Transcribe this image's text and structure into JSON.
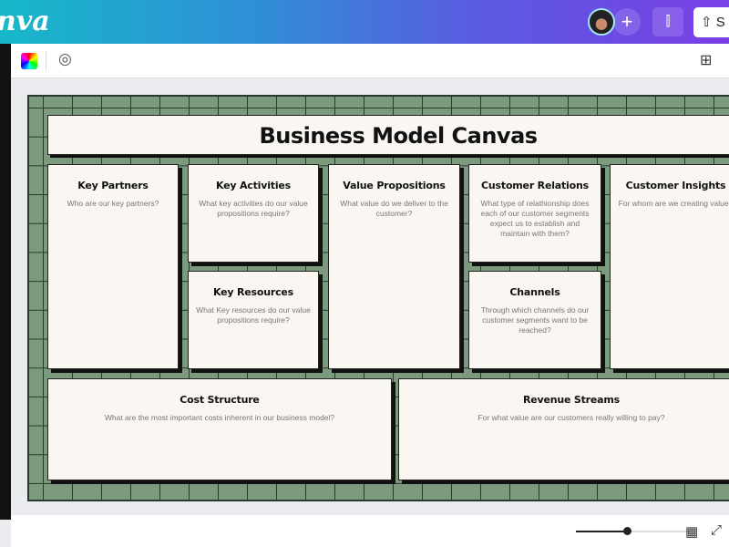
{
  "header": {
    "logo": "nva",
    "share_label": "S",
    "icons": [
      "avatar",
      "plus-icon",
      "stats-icon",
      "share-icon"
    ]
  },
  "toolbar": {
    "icons": [
      "color-picker",
      "animate-icon",
      "add-page-icon"
    ]
  },
  "board": {
    "title": "Business Model Canvas",
    "cards": [
      {
        "title": "Key Partners",
        "text": "Who are our key partners?"
      },
      {
        "title": "Key Activities",
        "text": "What key activities do our value propositions require?"
      },
      {
        "title": "Key Resources",
        "text": "What Key resources do our value propositions require?"
      },
      {
        "title": "Value Propositions",
        "text": "What value do we deliver to the customer?"
      },
      {
        "title": "Customer Relations",
        "text": "What type of relathionship does each of our customer segments expect us to establish and maintain with them?"
      },
      {
        "title": "Channels",
        "text": "Through which channels do our customer segments want to be reached?"
      },
      {
        "title": "Customer Insights",
        "text": "For whom are we creating value?"
      },
      {
        "title": "Cost Structure",
        "text": "What are the most important costs inherent in our business model?"
      },
      {
        "title": "Revenue Streams",
        "text": "For what value are our customers really willing to pay?"
      }
    ]
  },
  "footer": {
    "zoom_fraction": 0.45,
    "icons": [
      "grid-view-icon",
      "fullscreen-icon"
    ]
  },
  "colors": {
    "board_green": "#7c9a7d",
    "card_bg": "#faf7f3",
    "header_start": "#17b8c9",
    "header_end": "#7a3fe6"
  }
}
